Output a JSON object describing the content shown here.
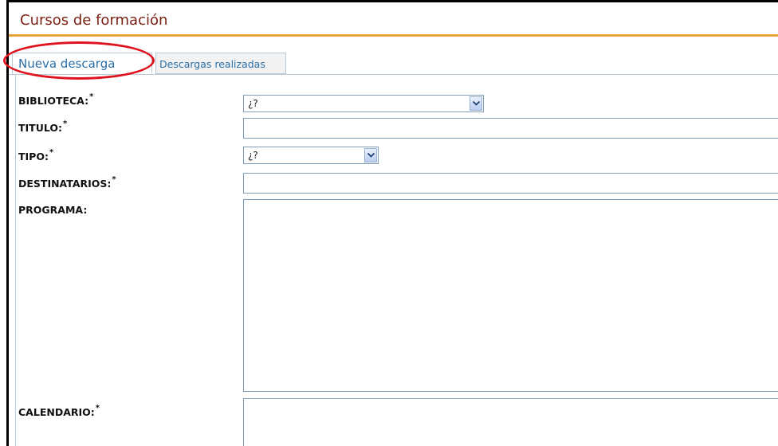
{
  "header": {
    "title": "Cursos de formación"
  },
  "tabs": [
    {
      "label": "Nueva descarga"
    },
    {
      "label": "Descargas realizadas"
    }
  ],
  "form": {
    "biblioteca": {
      "label": "BIBLIOTECA:",
      "required": "*",
      "value": "¿?"
    },
    "titulo": {
      "label": "TITULO:",
      "required": "*",
      "value": ""
    },
    "tipo": {
      "label": "TIPO:",
      "required": "*",
      "value": "¿?"
    },
    "destinatarios": {
      "label": "DESTINATARIOS:",
      "required": "*",
      "value": ""
    },
    "programa": {
      "label": "PROGRAMA:",
      "value": ""
    },
    "calendario": {
      "label": "CALENDARIO:",
      "required": "*",
      "value": ""
    }
  },
  "colors": {
    "title": "#7a1f10",
    "header_rule": "#e8a33a",
    "tab_text": "#2a6fa8",
    "highlight": "#e0121d"
  }
}
